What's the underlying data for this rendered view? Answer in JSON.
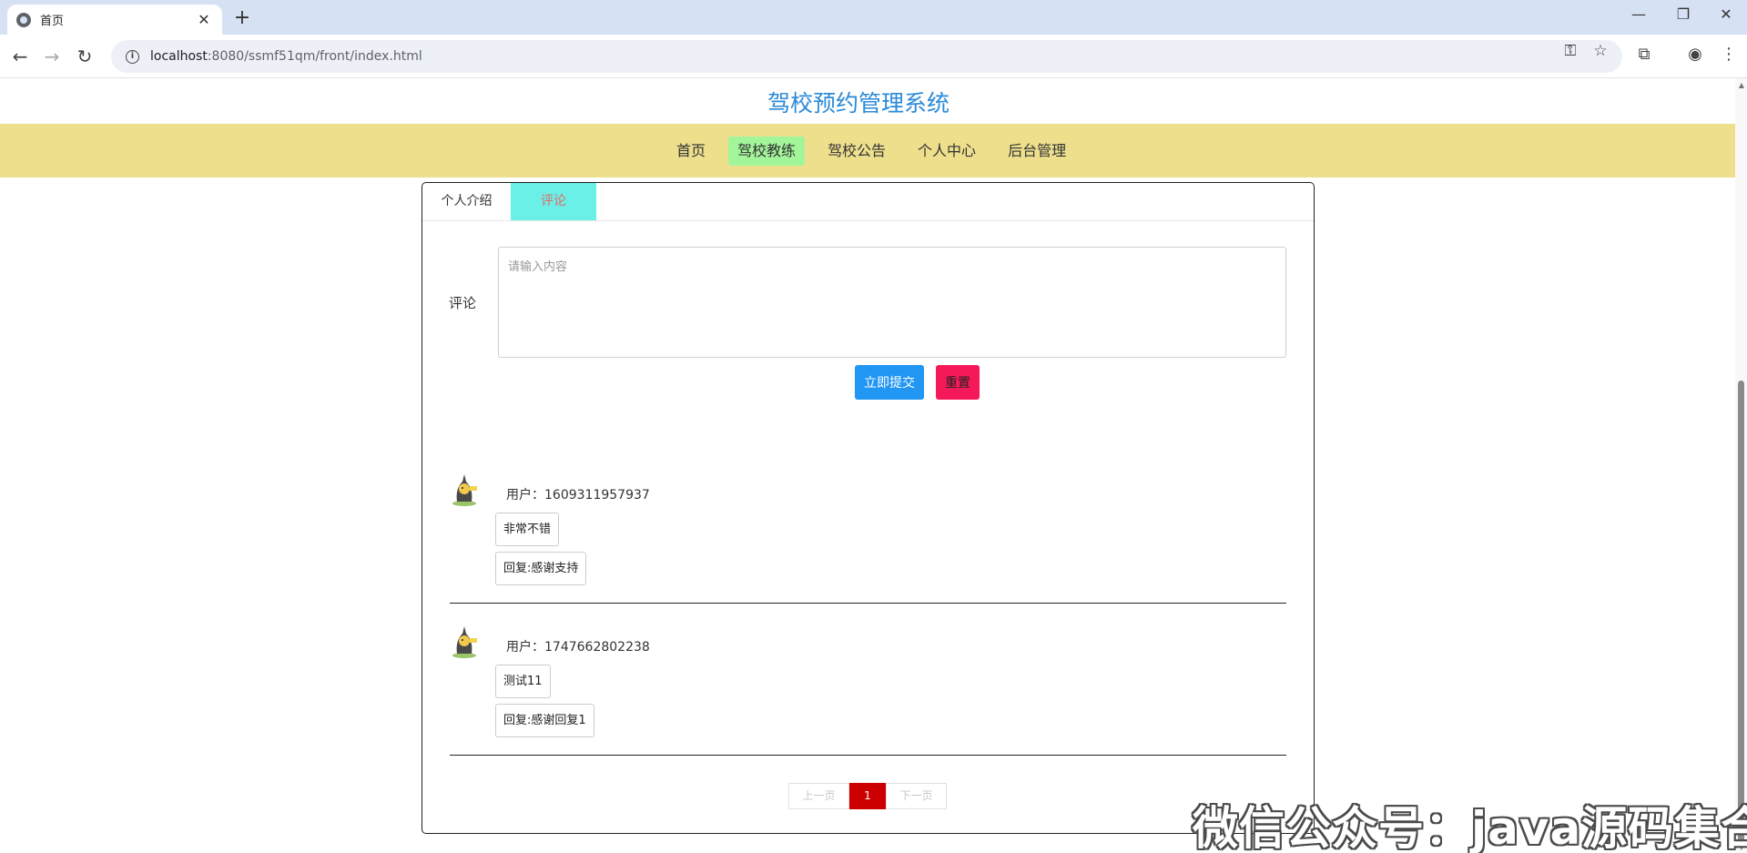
{
  "browser": {
    "tab_title": "首页",
    "url_host": "localhost",
    "url_rest": ":8080/ssmf51qm/front/index.html"
  },
  "site": {
    "title": "驾校预约管理系统",
    "nav": [
      {
        "label": "首页",
        "active": false
      },
      {
        "label": "驾校教练",
        "active": true
      },
      {
        "label": "驾校公告",
        "active": false
      },
      {
        "label": "个人中心",
        "active": false
      },
      {
        "label": "后台管理",
        "active": false
      }
    ],
    "nav_active_color": "#a3f59a",
    "navbar_color": "#eedf8d"
  },
  "panel": {
    "tabs": [
      {
        "label": "个人介绍",
        "active": false
      },
      {
        "label": "评论",
        "active": true
      }
    ],
    "form": {
      "label": "评论",
      "placeholder": "请输入内容",
      "submit_label": "立即提交",
      "reset_label": "重置"
    },
    "comments": [
      {
        "user": "用户：1609311957937",
        "content": "非常不错",
        "reply": "回复:感谢支持"
      },
      {
        "user": "用户：1747662802238",
        "content": "测试11",
        "reply": "回复:感谢回复1"
      }
    ],
    "pager": {
      "prev": "上一页",
      "current": "1",
      "next": "下一页"
    }
  },
  "watermark": "微信公众号：java源码集合"
}
